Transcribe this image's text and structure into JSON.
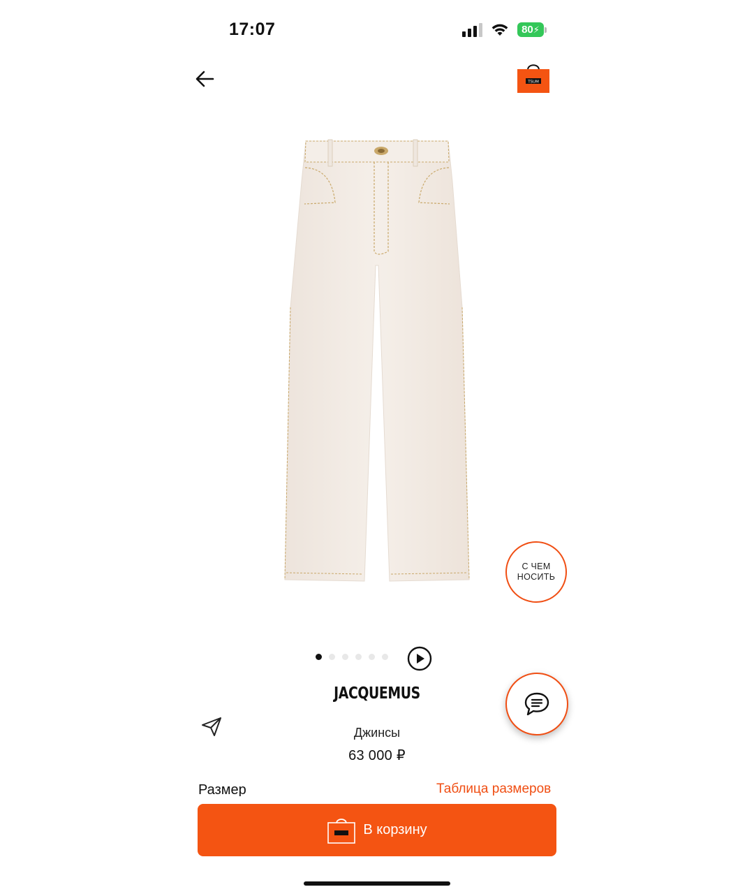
{
  "status_bar": {
    "time": "17:07",
    "battery": "80"
  },
  "header": {
    "back_icon": "arrow-left-icon",
    "logo_icon": "shopping-bag-logo-icon",
    "logo_text": "TSUM"
  },
  "product": {
    "image_desc_icon": "jeans-product-image",
    "brand": "JACQUEMUS",
    "name": "Джинсы",
    "price": "63 000 ₽",
    "gallery": {
      "total_slides": 6,
      "active_slide": 1
    }
  },
  "what_to_wear": {
    "line1": "С ЧЕМ",
    "line2": "НОСИТЬ"
  },
  "actions": {
    "share_icon": "paper-plane-icon",
    "chat_icon": "chat-bubble-icon",
    "play_icon": "play-icon"
  },
  "size": {
    "label": "Размер",
    "chart_link": "Таблица размеров"
  },
  "cart_button": {
    "label": "В корзину",
    "icon": "shopping-bag-icon"
  },
  "colors": {
    "accent": "#f45412",
    "accent_border": "#f04e13",
    "battery": "#34c759"
  }
}
